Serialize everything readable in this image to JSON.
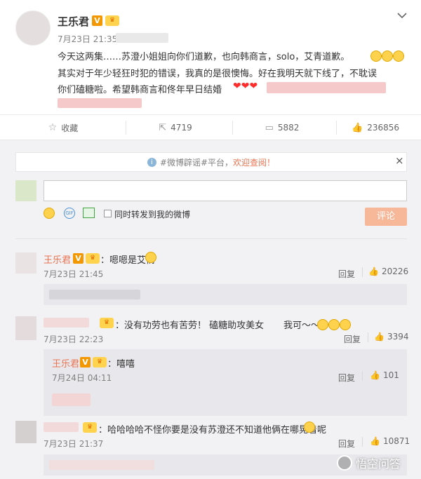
{
  "post": {
    "author": "王乐君",
    "time": "7月23日 21:35",
    "text_line1": "今天这两集……苏澄小姐姐向你们道歉，也向韩商言，solo，艾青道歉。",
    "text_line2": "其实对于年少轻狂时犯的错误，我真的是很懊悔。好在我明天就下线了，不耽误",
    "text_line3": "你们磕糖啦。希望韩商言和佟年早日结婚"
  },
  "actions": {
    "favorite": "收藏",
    "repost": "4719",
    "comment": "5882",
    "like": "236856"
  },
  "notice": {
    "text": "#微博辟谣#平台，",
    "link": "欢迎查阅！",
    "close": "×"
  },
  "composer": {
    "repost_checkbox": "同时转发到我的微博",
    "submit": "评论"
  },
  "comments": [
    {
      "name": "王乐君",
      "text": "：嗯嗯是艾情",
      "time": "7月23日 21:45",
      "reply": "回复",
      "likes": "20226"
    },
    {
      "text": "：没有功劳也有苦劳！ 磕糖助攻美女",
      "text2": "我可～～",
      "time": "7月23日 22:23",
      "reply": "回复",
      "likes": "3394"
    },
    {
      "name": "王乐君",
      "text": "：嘻嘻",
      "time": "7月24日 04:11",
      "reply": "回复",
      "likes": "101"
    },
    {
      "text": "：哈哈哈哈不怪你要是没有苏澄还不知道他俩在哪晃着呢",
      "time": "7月23日 21:37",
      "reply": "回复",
      "likes": "10871"
    }
  ],
  "watermark": "悟空问答"
}
